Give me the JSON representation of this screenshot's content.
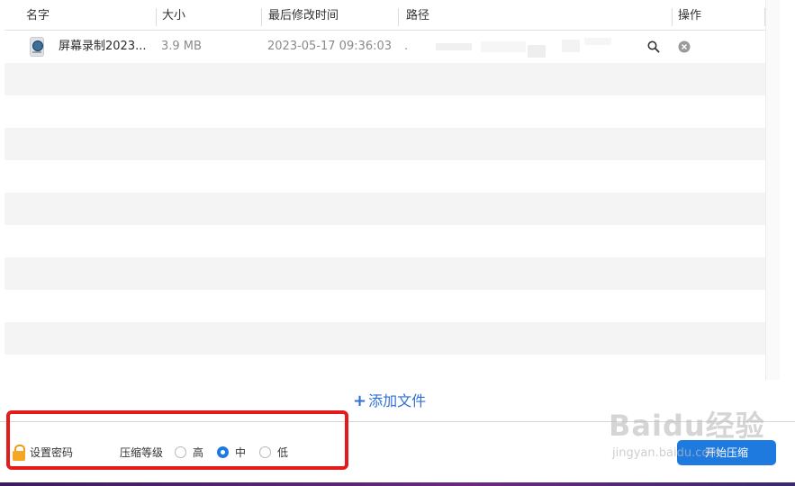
{
  "table": {
    "columns": [
      "名字",
      "大小",
      "最后修改时间",
      "路径",
      "操作"
    ],
    "rows": [
      {
        "name": "屏幕录制2023...",
        "size": "3.9 MB",
        "modified": "2023-05-17 09:36:03",
        "path": ".",
        "icon": "video-file-icon"
      }
    ],
    "empty_row_count": 10
  },
  "actions": {
    "add_file_plus": "+",
    "add_file_label": "添加文件",
    "set_password_label": "设置密码",
    "compression_level_label": "压缩等级",
    "levels": [
      "高",
      "中",
      "低"
    ],
    "selected_level": "中",
    "start_button_label": "开始压缩"
  },
  "watermark": {
    "main": "Baidu经验",
    "sub": "jingyan.baidu.com"
  },
  "colors": {
    "accent": "#1f7ae0",
    "highlight_box": "#e31b1b",
    "lock": "#f5a623",
    "row_alt": "#f4f4f4"
  }
}
